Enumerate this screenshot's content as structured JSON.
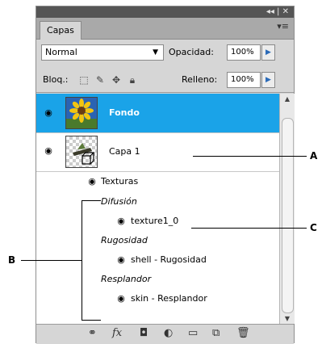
{
  "panel": {
    "title_controls": "◂◂ | ✕",
    "tab_label": "Capas",
    "menu_icon": "panel-menu-icon"
  },
  "blend": {
    "mode": "Normal",
    "opacity_label": "Opacidad:",
    "opacity_value": "100%"
  },
  "lock": {
    "label": "Bloq.:",
    "fill_label": "Relleno:",
    "fill_value": "100%"
  },
  "layers": [
    {
      "name": "Fondo",
      "selected": true
    },
    {
      "name": "Capa 1",
      "selected": false
    }
  ],
  "effects": {
    "group_label": "Texturas",
    "items": [
      {
        "category": "Difusión",
        "name": "texture1_0"
      },
      {
        "category": "Rugosidad",
        "name": "shell - Rugosidad"
      },
      {
        "category": "Resplandor",
        "name": "skin - Resplandor"
      }
    ]
  },
  "callouts": {
    "a": "A",
    "b": "B",
    "c": "C"
  },
  "colors": {
    "selected_layer": "#1aa3e8",
    "panel_bg": "#d6d6d6"
  }
}
